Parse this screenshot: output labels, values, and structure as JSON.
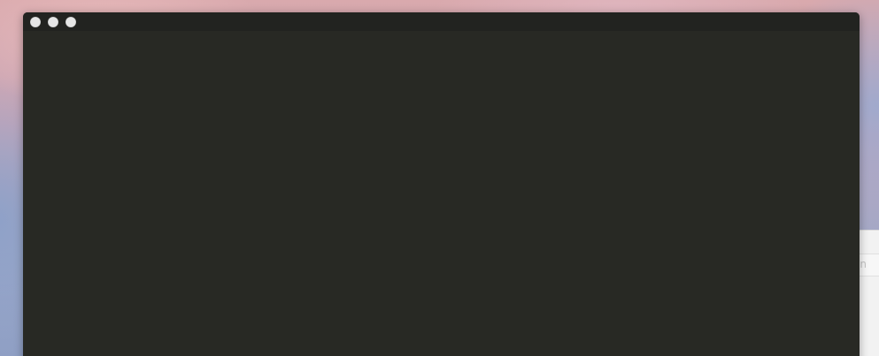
{
  "desktop": {
    "background_panel": {
      "partial_text": "n"
    }
  },
  "window": {
    "theme": {
      "background": "#282924",
      "titlebar": "#222320",
      "traffic_light": "#e6e6e6"
    },
    "controls": [
      "close-button",
      "minimize-button",
      "zoom-button"
    ],
    "content_text": ""
  }
}
